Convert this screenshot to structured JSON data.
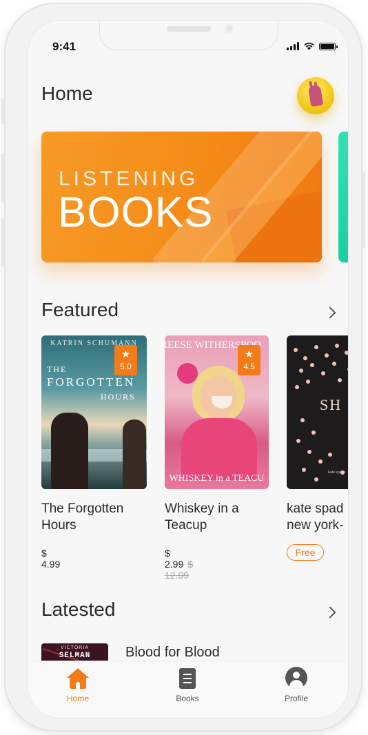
{
  "status_bar": {
    "time": "9:41"
  },
  "header": {
    "title": "Home"
  },
  "banner": {
    "line1": "LISTENING",
    "line2": "BOOKS"
  },
  "featured": {
    "title": "Featured",
    "books": [
      {
        "title": "The Forgotten Hours",
        "price": "$ 4.99",
        "rating": "5.0",
        "cover": {
          "author": "KATRIN SCHUMANN",
          "line1": "THE",
          "line2": "FORGOTTEN",
          "line3": "HOURS"
        }
      },
      {
        "title": "Whiskey in a Teacup",
        "price": "$ 2.99",
        "old_price": "$ 12.99",
        "rating": "4.5",
        "cover": {
          "author": "REESE WITHERSPOO",
          "subtitle": "WHISKEY in a TEACU"
        }
      },
      {
        "title": "kate spad new york-",
        "badge": "Free",
        "cover": {
          "title": "SH",
          "brand": "kate spade"
        }
      }
    ]
  },
  "latest": {
    "title": "Latested",
    "items": [
      {
        "title": "Blood for Blood",
        "cover": {
          "author": "VICTORIA",
          "name": "SELMAN"
        }
      }
    ]
  },
  "tabbar": {
    "tabs": [
      {
        "label": "Home",
        "icon": "home-icon",
        "active": true
      },
      {
        "label": "Books",
        "icon": "books-icon",
        "active": false
      },
      {
        "label": "Profile",
        "icon": "profile-icon",
        "active": false
      }
    ]
  },
  "colors": {
    "accent": "#f37c18",
    "banner": "#f58b18",
    "peek_card": "#1ccf9f"
  }
}
